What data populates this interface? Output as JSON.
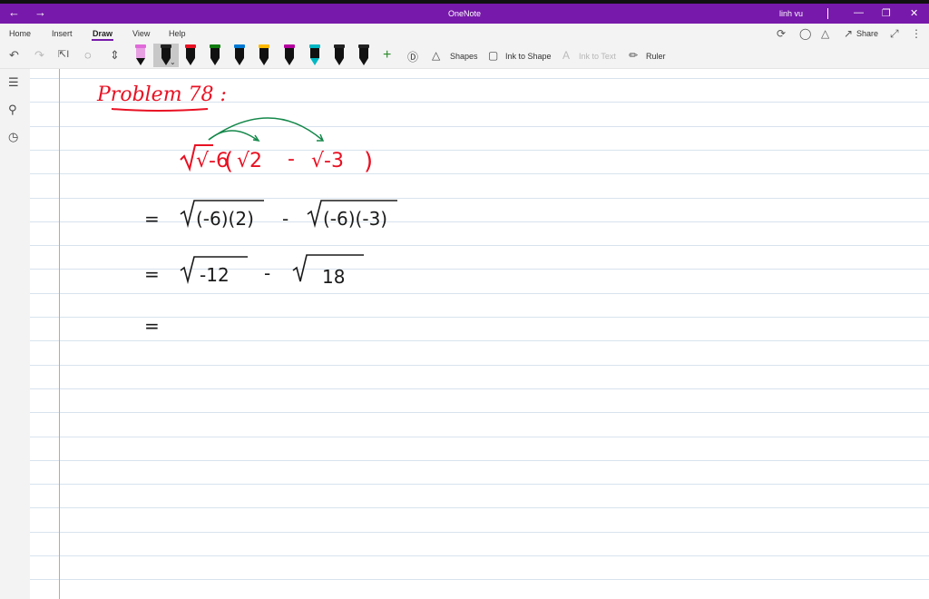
{
  "window": {
    "title": "OneNote",
    "user": "linh vu"
  },
  "menu": {
    "tabs": [
      "Home",
      "Insert",
      "Draw",
      "View",
      "Help"
    ],
    "active": "Draw",
    "share_label": "Share"
  },
  "toolbar": {
    "pens": [
      {
        "icon": "highlighter-pen-icon",
        "color": "#e06ad9"
      },
      {
        "icon": "pen-icon",
        "color": "#222222"
      },
      {
        "icon": "pen-icon",
        "color": "#e81123"
      },
      {
        "icon": "pen-icon",
        "color": "#107c10"
      },
      {
        "icon": "pen-icon",
        "color": "#0078d4"
      },
      {
        "icon": "pen-icon",
        "color": "#ffb900"
      },
      {
        "icon": "pen-icon",
        "color": "#b4009e"
      },
      {
        "icon": "highlighter-icon",
        "color": "#00b7c3"
      },
      {
        "icon": "pen-icon",
        "color": "#222222"
      },
      {
        "icon": "pen-icon",
        "color": "#222222"
      }
    ],
    "shapes_label": "Shapes",
    "ink_to_shape_label": "Ink to Shape",
    "ink_to_text_label": "Ink to Text",
    "ruler_label": "Ruler"
  },
  "note": {
    "heading": "Problem 78 :",
    "expression": [
      "√-6",
      "(",
      "√2",
      "-",
      "√-3",
      ")"
    ],
    "steps": [
      {
        "prefix": "=",
        "left": "(-6)(2)",
        "op": "-",
        "right": "(-6)(-3)"
      },
      {
        "prefix": "=",
        "left": "-12",
        "op": "-",
        "right": "18"
      },
      {
        "prefix": "="
      }
    ],
    "colors": {
      "red": "#e81123",
      "green": "#14884a",
      "black": "#1a1a1a",
      "accent": "#7719aa",
      "rule_line": "#d8e3ee",
      "margin_line": "#d99a9a"
    }
  }
}
